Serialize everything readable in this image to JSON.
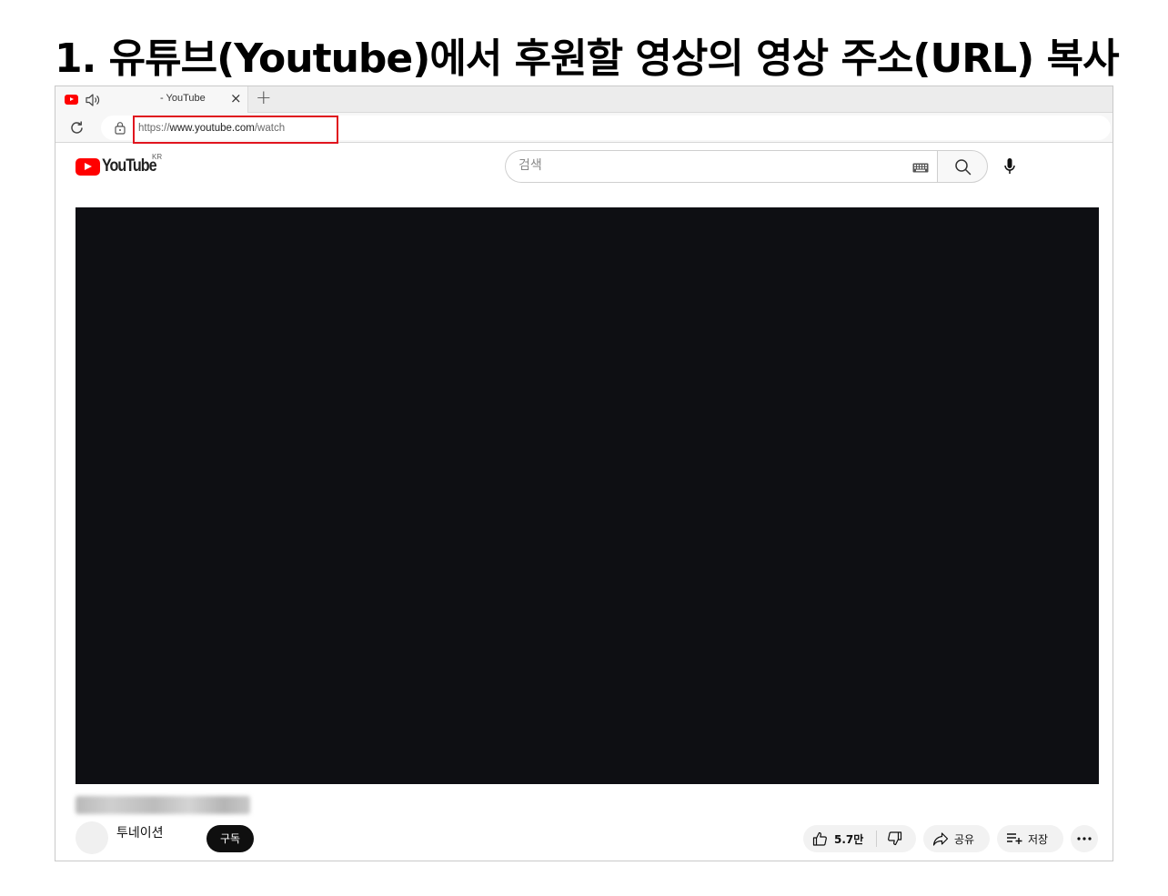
{
  "page": {
    "title": "1. 유튜브(Youtube)에서 후원할 영상의 영상 주소(URL) 복사"
  },
  "browser": {
    "tab": {
      "title": "- YouTube",
      "close": "×",
      "new_tab": "+"
    },
    "address": {
      "url_scheme": "https://",
      "url_host": "www.youtube.com",
      "url_path": "/watch",
      "highlight_color": "#e0141e"
    }
  },
  "youtube": {
    "logo_text": "YouTube",
    "region": "KR",
    "search_placeholder": "검색",
    "brand_color": "#ff0000",
    "channel": {
      "name": "투네이션",
      "subscribe_label": "구독"
    },
    "actions": {
      "like_count": "5.7만",
      "share_label": "공유",
      "save_label": "저장"
    }
  }
}
